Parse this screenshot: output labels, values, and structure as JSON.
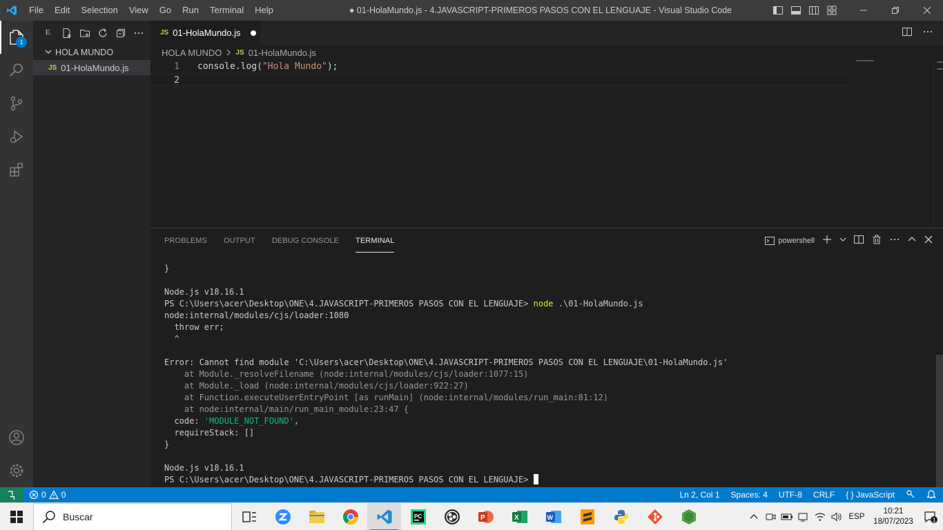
{
  "window": {
    "title": "● 01-HolaMundo.js - 4.JAVASCRIPT-PRIMEROS PASOS CON EL LENGUAJE - Visual Studio Code",
    "menu": [
      "File",
      "Edit",
      "Selection",
      "View",
      "Go",
      "Run",
      "Terminal",
      "Help"
    ]
  },
  "activity": {
    "explorer_badge": "1"
  },
  "sidebar": {
    "title": "E.",
    "folder": "HOLA MUNDO",
    "file_icon": "JS",
    "file": "01-HolaMundo.js"
  },
  "editor": {
    "tab_icon": "JS",
    "tab_label": "01-HolaMundo.js",
    "breadcrumb_folder": "HOLA MUNDO",
    "breadcrumb_icon": "JS",
    "breadcrumb_file": "01-HolaMundo.js",
    "lines": [
      {
        "num": "1",
        "obj": "console",
        "dot": ".",
        "fn": "log",
        "open": "(",
        "str": "\"Hola Mundo\"",
        "close": ");"
      },
      {
        "num": "2"
      }
    ]
  },
  "panel": {
    "tabs": [
      "PROBLEMS",
      "OUTPUT",
      "DEBUG CONSOLE",
      "TERMINAL"
    ],
    "shell": "powershell",
    "terminal": [
      "}",
      "",
      "Node.js v18.16.1",
      "PS C:\\Users\\acer\\Desktop\\ONE\\4.JAVASCRIPT-PRIMEROS PASOS CON EL LENGUAJE> ",
      "node:internal/modules/cjs/loader:1080",
      "  throw err;",
      "  ^",
      "",
      "Error: Cannot find module 'C:\\Users\\acer\\Desktop\\ONE\\4.JAVASCRIPT-PRIMEROS PASOS CON EL LENGUAJE\\01-HolaMundo.js'",
      "    at Module._resolveFilename (node:internal/modules/cjs/loader:1077:15)",
      "    at Module._load (node:internal/modules/cjs/loader:922:27)",
      "    at Function.executeUserEntryPoint [as runMain] (node:internal/modules/run_main:81:12)",
      "    at node:internal/main/run_main_module:23:47 {",
      "  code: ",
      "  requireStack: []",
      "}",
      "",
      "Node.js v18.16.1",
      "PS C:\\Users\\acer\\Desktop\\ONE\\4.JAVASCRIPT-PRIMEROS PASOS CON EL LENGUAJE> "
    ],
    "cmd_node": "node",
    "cmd_arg": " .\\01-HolaMundo.js",
    "code_value": "'MODULE_NOT_FOUND'",
    "code_after": ","
  },
  "status": {
    "errors": "0",
    "warnings": "0",
    "position": "Ln 2, Col 1",
    "spaces": "Spaces: 4",
    "encoding": "UTF-8",
    "eol": "CRLF",
    "language_brace": "{ }",
    "language": "JavaScript"
  },
  "taskbar": {
    "search_placeholder": "Buscar",
    "lang": "ESP",
    "time": "10:21",
    "date": "18/07/2023",
    "notif_count": "1"
  },
  "colors": {
    "statusbar": "#007acc",
    "activitybar": "#333333",
    "sidebar": "#252526",
    "editor": "#1e1e1e"
  }
}
